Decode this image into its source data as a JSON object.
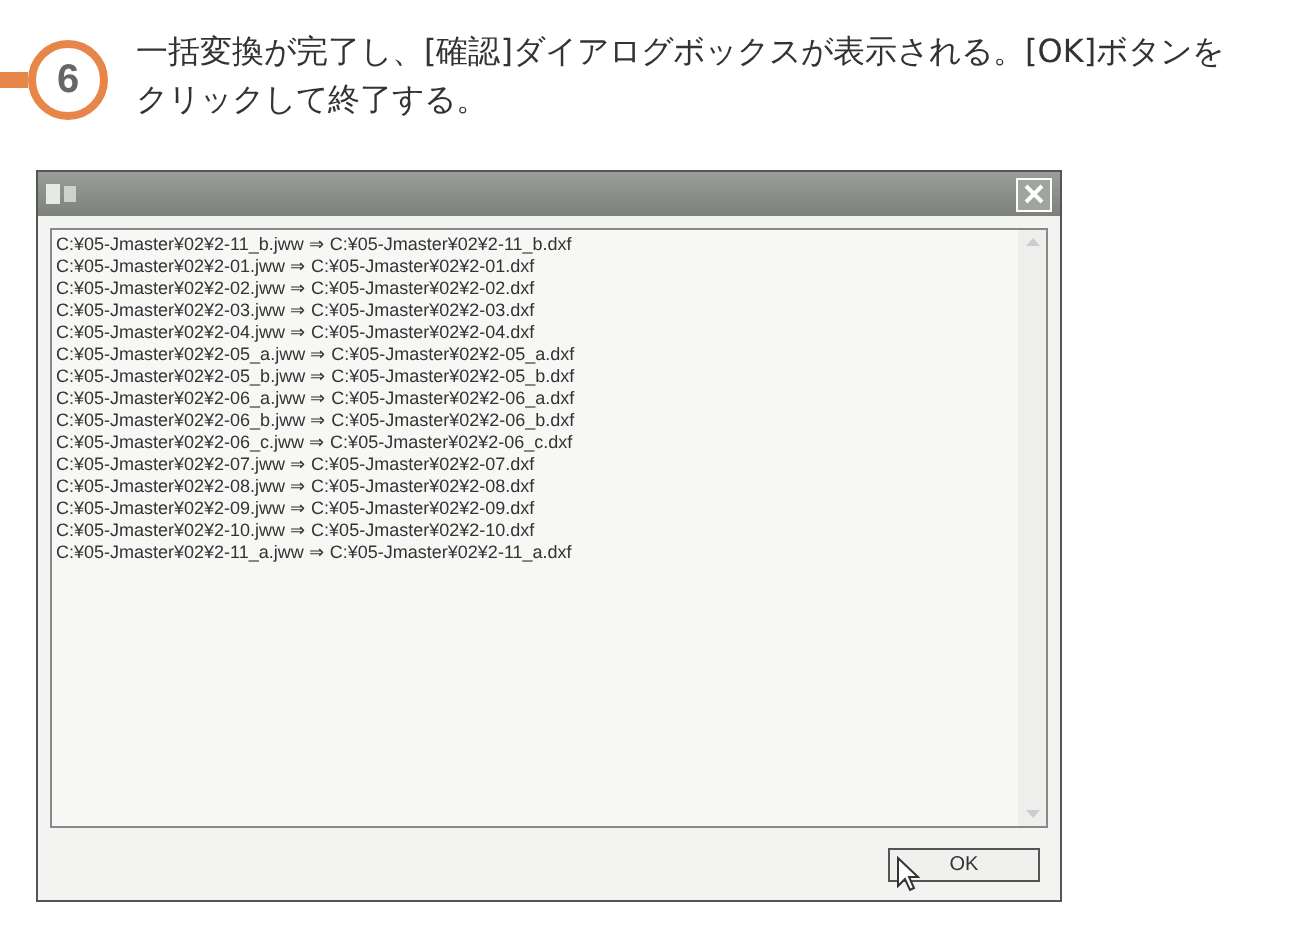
{
  "step": {
    "number": "6",
    "text": "一括変換が完了し、[確認]ダイアログボックスが表示される。[OK]ボタンをクリックして終了する。"
  },
  "dialog": {
    "lines": [
      "C:¥05-Jmaster¥02¥2-11_b.jww ⇒ C:¥05-Jmaster¥02¥2-11_b.dxf",
      "C:¥05-Jmaster¥02¥2-01.jww ⇒ C:¥05-Jmaster¥02¥2-01.dxf",
      "C:¥05-Jmaster¥02¥2-02.jww ⇒ C:¥05-Jmaster¥02¥2-02.dxf",
      "C:¥05-Jmaster¥02¥2-03.jww ⇒ C:¥05-Jmaster¥02¥2-03.dxf",
      "C:¥05-Jmaster¥02¥2-04.jww ⇒ C:¥05-Jmaster¥02¥2-04.dxf",
      "C:¥05-Jmaster¥02¥2-05_a.jww ⇒ C:¥05-Jmaster¥02¥2-05_a.dxf",
      "C:¥05-Jmaster¥02¥2-05_b.jww ⇒ C:¥05-Jmaster¥02¥2-05_b.dxf",
      "C:¥05-Jmaster¥02¥2-06_a.jww ⇒ C:¥05-Jmaster¥02¥2-06_a.dxf",
      "C:¥05-Jmaster¥02¥2-06_b.jww ⇒ C:¥05-Jmaster¥02¥2-06_b.dxf",
      "C:¥05-Jmaster¥02¥2-06_c.jww ⇒ C:¥05-Jmaster¥02¥2-06_c.dxf",
      "C:¥05-Jmaster¥02¥2-07.jww ⇒ C:¥05-Jmaster¥02¥2-07.dxf",
      "C:¥05-Jmaster¥02¥2-08.jww ⇒ C:¥05-Jmaster¥02¥2-08.dxf",
      "C:¥05-Jmaster¥02¥2-09.jww ⇒ C:¥05-Jmaster¥02¥2-09.dxf",
      "C:¥05-Jmaster¥02¥2-10.jww ⇒ C:¥05-Jmaster¥02¥2-10.dxf",
      "C:¥05-Jmaster¥02¥2-11_a.jww ⇒ C:¥05-Jmaster¥02¥2-11_a.dxf"
    ],
    "button": "OK"
  }
}
